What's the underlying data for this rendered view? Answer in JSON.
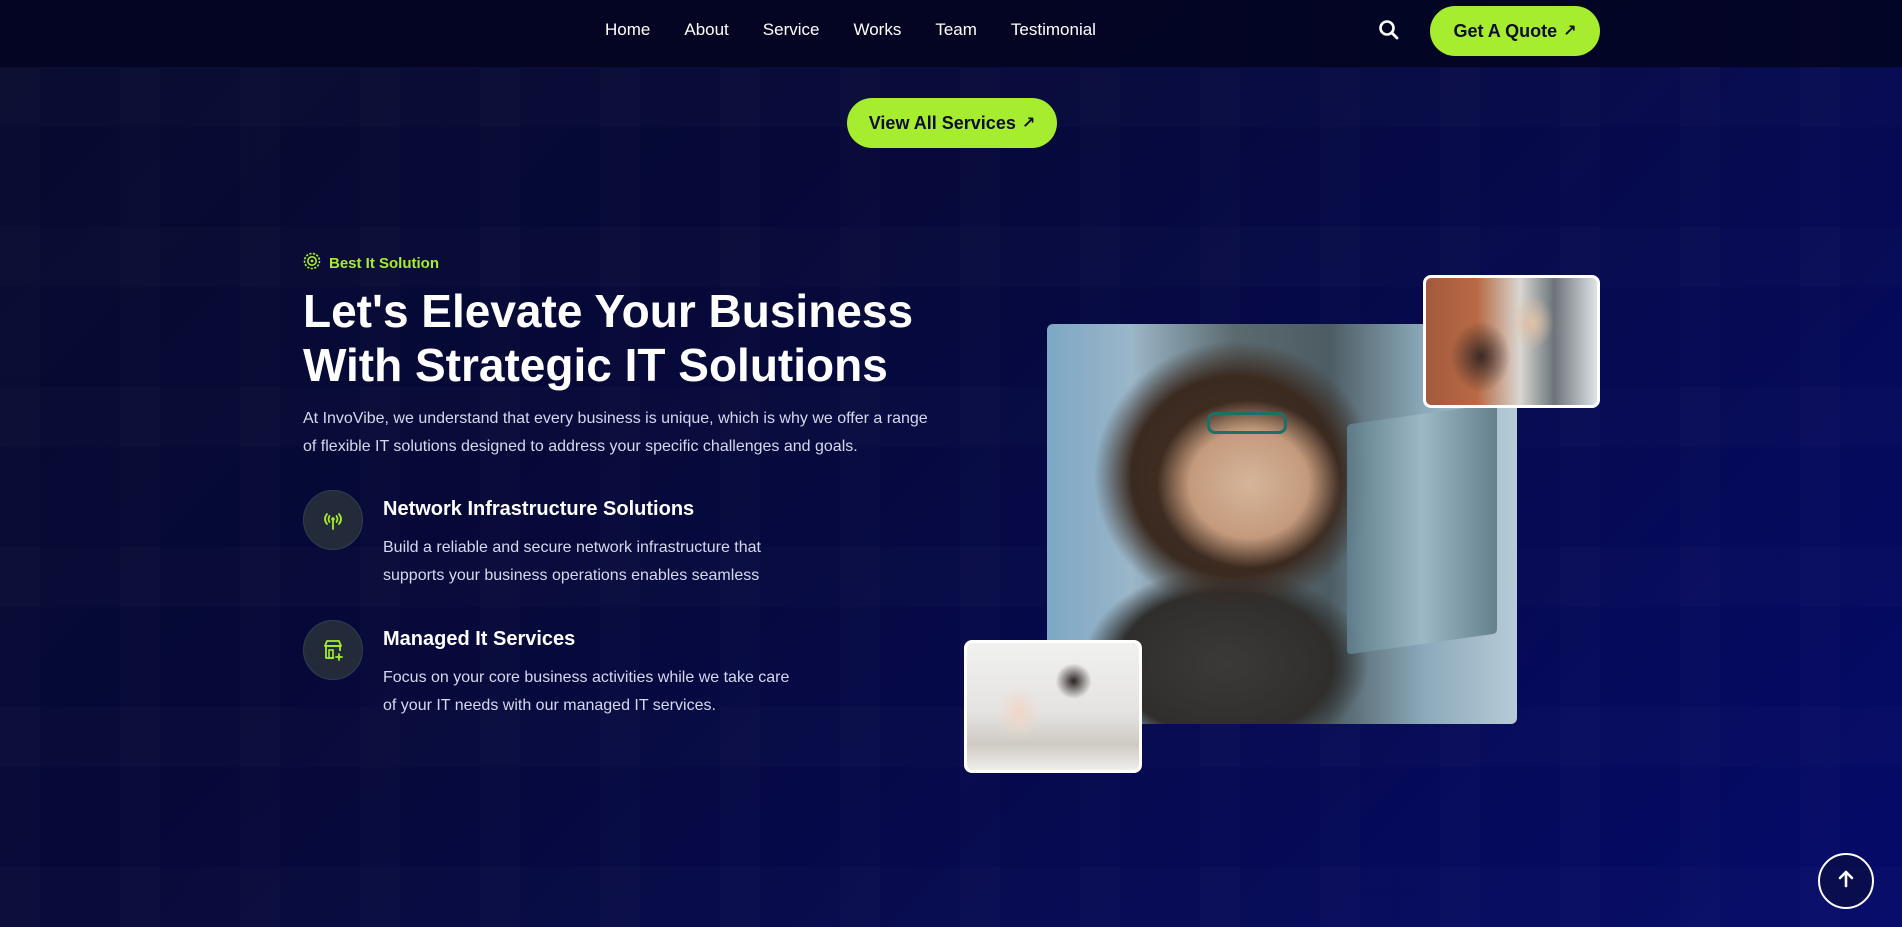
{
  "nav": {
    "links": [
      "Home",
      "About",
      "Service",
      "Works",
      "Team",
      "Testimonial"
    ],
    "quote_label": "Get A Quote"
  },
  "services": {
    "view_all_label": "View All Services"
  },
  "about": {
    "eyebrow": "Best It Solution",
    "headline": "Let's Elevate Your Business With Strategic IT Solutions",
    "lead": "At InvoVibe, we understand that every business is unique, which is why we offer a range of flexible IT solutions designed to address your specific challenges and goals.",
    "features": [
      {
        "title": "Network Infrastructure Solutions",
        "desc": "Build a reliable and secure network infrastructure that supports your business operations enables seamless",
        "icon": "antenna-icon"
      },
      {
        "title": "Managed It Services",
        "desc": "Focus on your core business activities while we take care of your IT needs with our managed IT services.",
        "icon": "shop-add-icon"
      }
    ]
  },
  "colors": {
    "accent": "#a6ed2f",
    "background": "#06093a"
  }
}
